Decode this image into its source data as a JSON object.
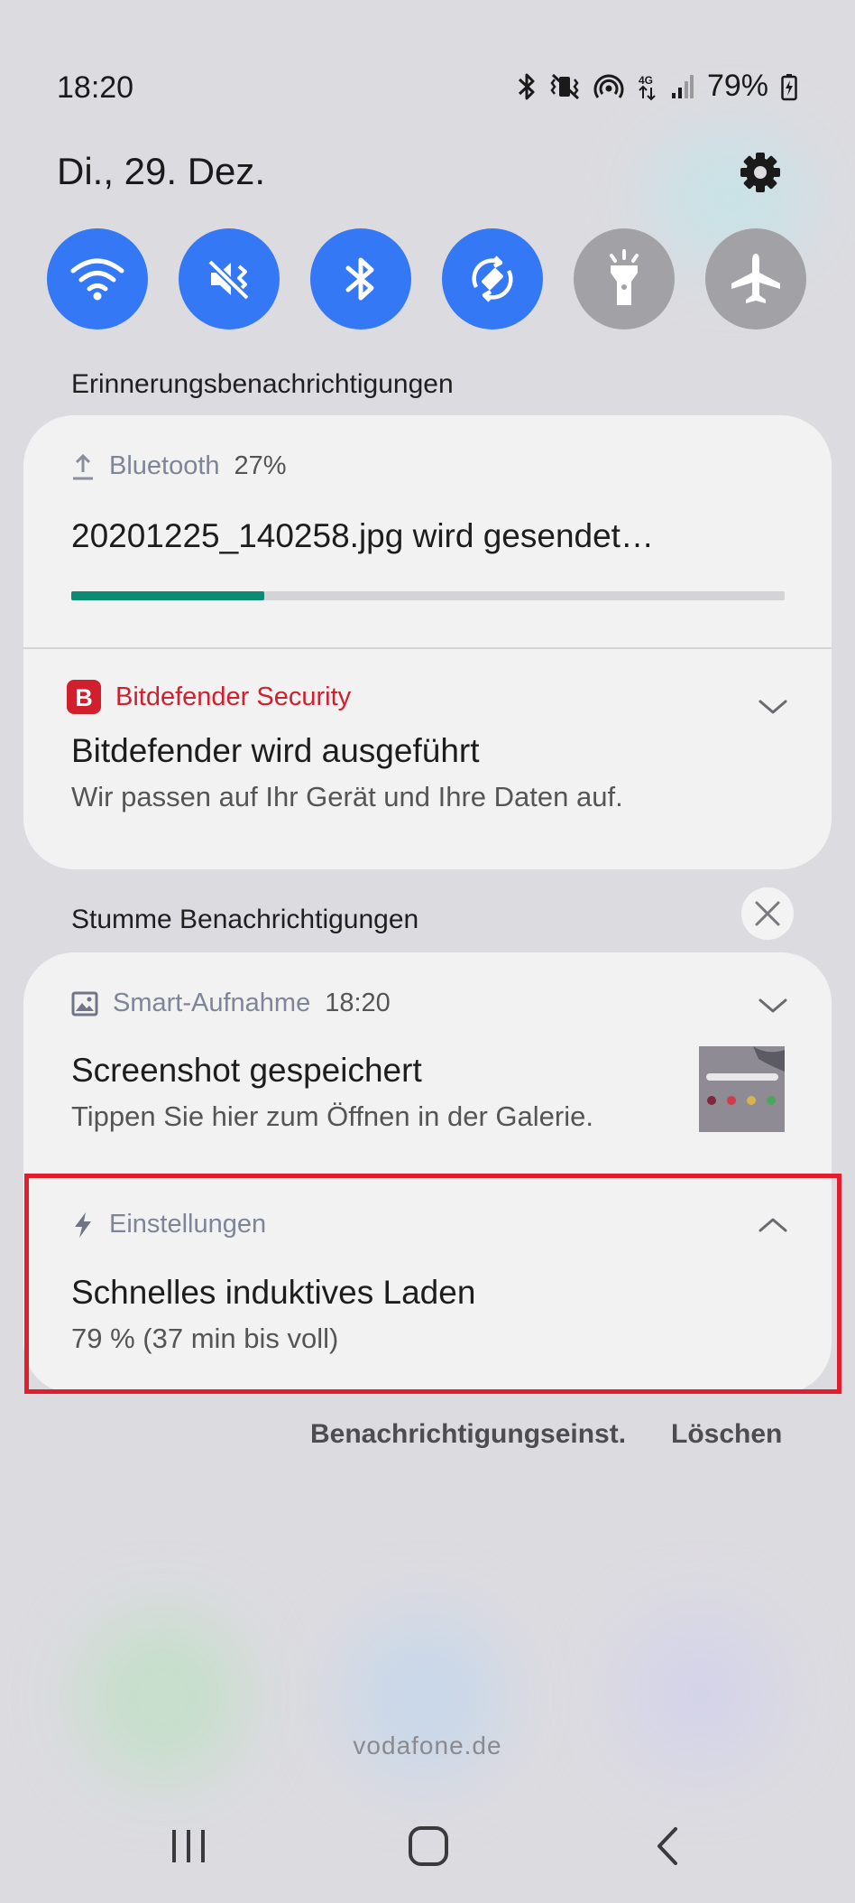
{
  "status_bar": {
    "time": "18:20",
    "battery": "79%",
    "network": "4G",
    "icons": [
      "bluetooth-icon",
      "vibrate-mute-icon",
      "hotspot-icon",
      "network-4g-icon",
      "signal-icon",
      "battery-charging-icon"
    ]
  },
  "header": {
    "date": "Di., 29. Dez."
  },
  "quick_toggles": [
    {
      "name": "wifi",
      "state": "on"
    },
    {
      "name": "sound-mute",
      "state": "on"
    },
    {
      "name": "bluetooth",
      "state": "on"
    },
    {
      "name": "auto-rotate",
      "state": "on"
    },
    {
      "name": "flashlight",
      "state": "off"
    },
    {
      "name": "airplane-mode",
      "state": "off"
    }
  ],
  "sections": {
    "alerting": "Erinnerungsbenachrichtigungen",
    "silent": "Stumme Benachrichtigungen"
  },
  "notifications": {
    "bluetooth": {
      "app": "Bluetooth",
      "meta": "27%",
      "title": "20201225_140258.jpg wird gesendet…",
      "progress": 0.27
    },
    "bitdefender": {
      "app": "Bitdefender Security",
      "title": "Bitdefender wird ausgeführt",
      "body": "Wir passen auf Ihr Gerät und Ihre Daten auf."
    },
    "screenshot": {
      "app": "Smart-Aufnahme",
      "meta": "18:20",
      "title": "Screenshot gespeichert",
      "body": "Tippen Sie hier zum Öffnen in der Galerie."
    },
    "charging": {
      "app": "Einstellungen",
      "title": "Schnelles induktives Laden",
      "body": "79 % (37 min bis voll)"
    }
  },
  "actions": {
    "notification_settings": "Benachrichtigungseinst.",
    "clear": "Löschen"
  },
  "carrier": "vodafone.de",
  "colors": {
    "accent": "#3478f6",
    "progress": "#0c8a73",
    "bitdefender_red": "#d0202e",
    "highlight": "#e21d2e"
  }
}
